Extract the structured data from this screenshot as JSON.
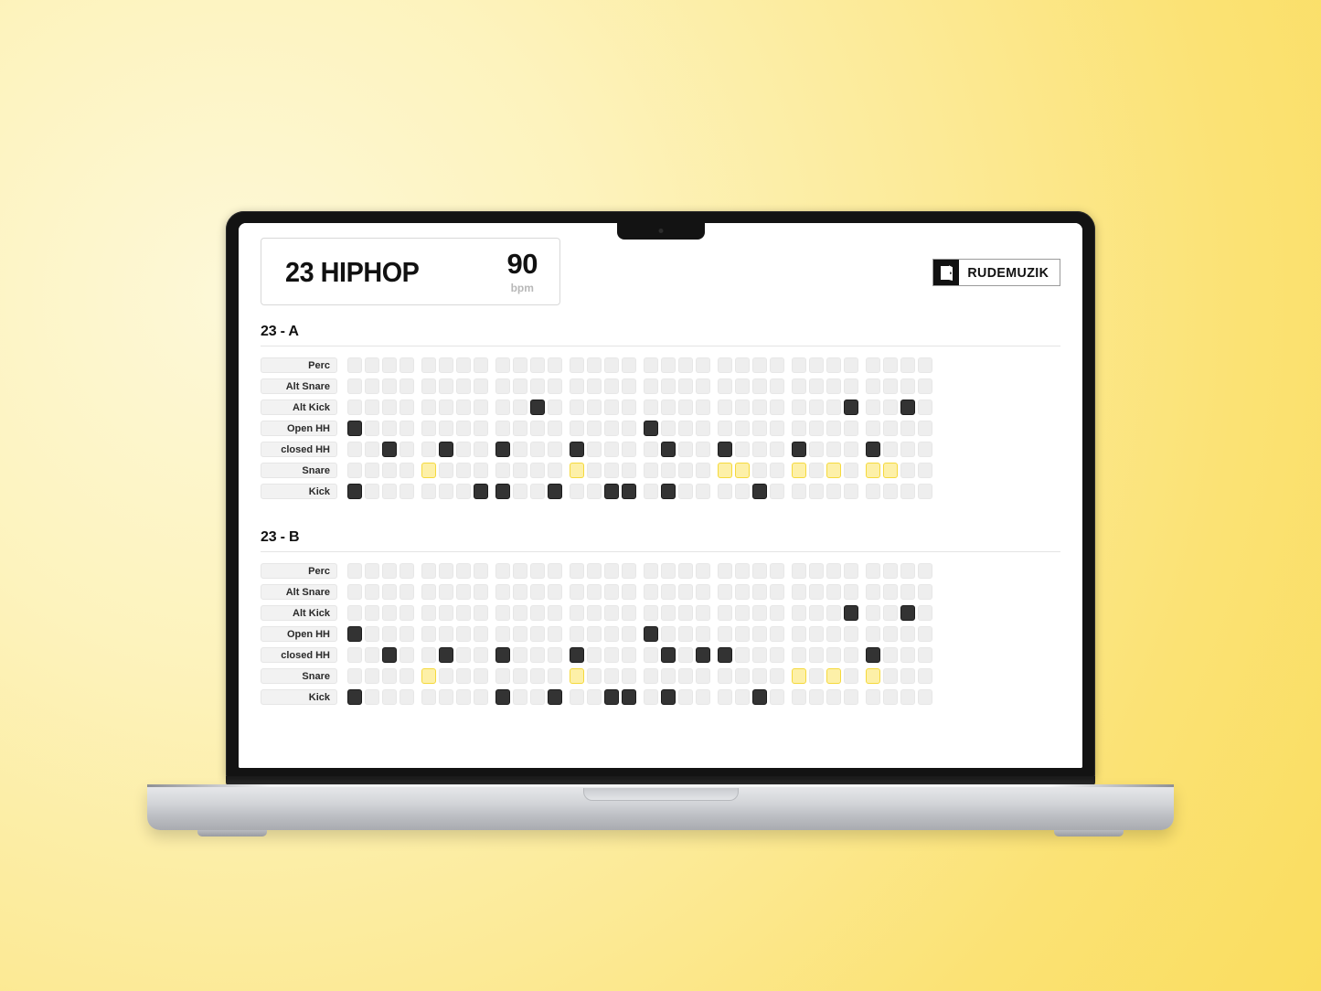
{
  "app": {
    "pattern_title": "23 HIPHOP",
    "tempo_value": "90",
    "tempo_unit": "bpm",
    "brand_name": "RUDEMUZIK",
    "brand_mark_icon": "door-icon"
  },
  "colors": {
    "background_light": "#fdf8d8",
    "background_deep": "#fadd5e",
    "step_off": "#eeeeee",
    "step_on_dark": "#333333",
    "step_on_accent": "#fdf0a8",
    "step_on_accent_border": "#f5d93c"
  },
  "grid": {
    "steps_per_pattern": 32,
    "steps_per_group": 4,
    "tracks": [
      "Perc",
      "Alt Snare",
      "Alt Kick",
      "Open HH",
      "closed HH",
      "Snare",
      "Kick"
    ]
  },
  "sections": [
    {
      "id": "section-a",
      "label": "23 - A",
      "tracks": [
        {
          "name": "Perc",
          "accent": false,
          "steps": []
        },
        {
          "name": "Alt Snare",
          "accent": false,
          "steps": []
        },
        {
          "name": "Alt Kick",
          "accent": false,
          "steps": [
            11,
            28,
            31
          ]
        },
        {
          "name": "Open HH",
          "accent": false,
          "steps": [
            1,
            17
          ]
        },
        {
          "name": "closed HH",
          "accent": false,
          "steps": [
            3,
            6,
            9,
            13,
            18,
            21,
            25,
            29
          ]
        },
        {
          "name": "Snare",
          "accent": true,
          "steps": [
            5,
            13,
            21,
            22,
            25,
            27,
            29,
            30
          ]
        },
        {
          "name": "Kick",
          "accent": false,
          "steps": [
            1,
            8,
            9,
            12,
            15,
            16,
            18,
            23
          ]
        }
      ]
    },
    {
      "id": "section-b",
      "label": "23 - B",
      "tracks": [
        {
          "name": "Perc",
          "accent": false,
          "steps": []
        },
        {
          "name": "Alt Snare",
          "accent": false,
          "steps": []
        },
        {
          "name": "Alt Kick",
          "accent": false,
          "steps": [
            28,
            31
          ]
        },
        {
          "name": "Open HH",
          "accent": false,
          "steps": [
            1,
            17
          ]
        },
        {
          "name": "closed HH",
          "accent": false,
          "steps": [
            3,
            6,
            9,
            13,
            18,
            20,
            21,
            29
          ]
        },
        {
          "name": "Snare",
          "accent": true,
          "steps": [
            5,
            13,
            25,
            27,
            29
          ]
        },
        {
          "name": "Kick",
          "accent": false,
          "steps": [
            1,
            9,
            12,
            15,
            16,
            18,
            23
          ]
        }
      ]
    }
  ]
}
